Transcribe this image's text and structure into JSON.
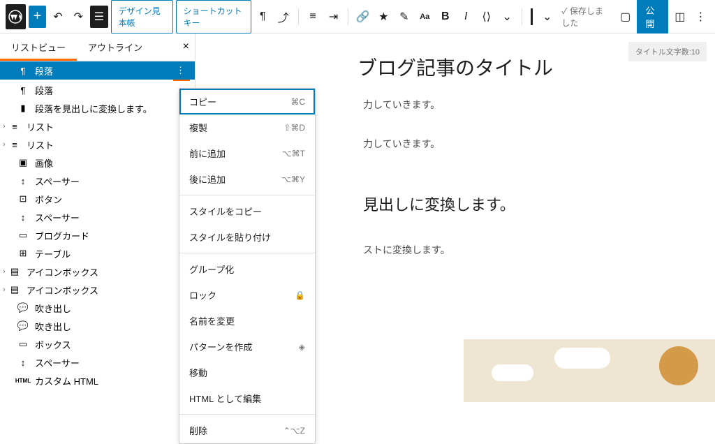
{
  "toolbar": {
    "design_sample": "デザイン見本帳",
    "shortcut_keys": "ショートカットキー",
    "saved": "✓ 保存しました",
    "publish": "公開"
  },
  "tabs": {
    "list_view": "リストビュー",
    "outline": "アウトライン"
  },
  "word_count": "タイトル文字数:10",
  "blocks": [
    {
      "icon": "¶",
      "label": "段落",
      "selected": true,
      "more": true
    },
    {
      "icon": "¶",
      "label": "段落"
    },
    {
      "icon": "▮",
      "label": "段落を見出しに変換します。"
    },
    {
      "icon": "≡",
      "label": "リスト",
      "chev": "›",
      "nest": true
    },
    {
      "icon": "≡",
      "label": "リスト",
      "chev": "›",
      "nest": true
    },
    {
      "icon": "▣",
      "label": "画像",
      "thumb": true
    },
    {
      "icon": "↕",
      "label": "スペーサー"
    },
    {
      "icon": "⊡",
      "label": "ボタン"
    },
    {
      "icon": "↕",
      "label": "スペーサー"
    },
    {
      "icon": "▭",
      "label": "ブログカード"
    },
    {
      "icon": "⊞",
      "label": "テーブル"
    },
    {
      "icon": "▤",
      "label": "アイコンボックス",
      "chev": "›",
      "nest": true
    },
    {
      "icon": "▤",
      "label": "アイコンボックス",
      "chev": "›",
      "nest": true
    },
    {
      "icon": "💬",
      "label": "吹き出し"
    },
    {
      "icon": "💬",
      "label": "吹き出し"
    },
    {
      "icon": "▭",
      "label": "ボックス"
    },
    {
      "icon": "↕",
      "label": "スペーサー"
    },
    {
      "icon": "HTML",
      "label": "カスタム HTML"
    }
  ],
  "ctx": [
    {
      "label": "コピー",
      "sc": "⌘C",
      "hl": true
    },
    {
      "label": "複製",
      "sc": "⇧⌘D"
    },
    {
      "label": "前に追加",
      "sc": "⌥⌘T"
    },
    {
      "label": "後に追加",
      "sc": "⌥⌘Y"
    },
    {
      "sep": true
    },
    {
      "label": "スタイルをコピー"
    },
    {
      "label": "スタイルを貼り付け"
    },
    {
      "sep": true
    },
    {
      "label": "グループ化"
    },
    {
      "label": "ロック",
      "sc": "🔒"
    },
    {
      "label": "名前を変更"
    },
    {
      "label": "パターンを作成",
      "sc": "◈"
    },
    {
      "label": "移動"
    },
    {
      "label": "HTML として編集"
    },
    {
      "sep": true
    },
    {
      "label": "削除",
      "sc": "⌃⌥Z"
    }
  ],
  "content": {
    "title": "ブログ記事のタイトル",
    "p1": "力していきます。",
    "p2": "力していきます。",
    "h2a": "見出しに変換します。",
    "p3": "ストに変換します。"
  }
}
